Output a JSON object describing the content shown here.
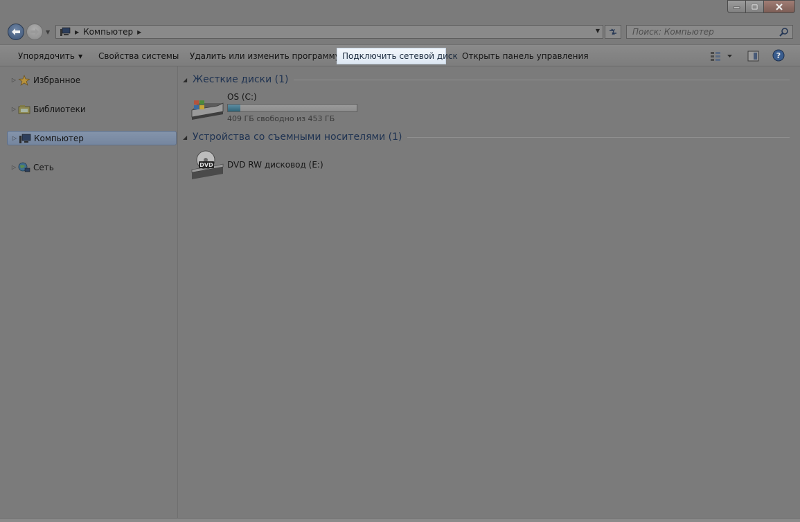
{
  "window": {
    "caption_buttons": [
      "minimize-icon",
      "maximize-icon",
      "close-icon"
    ]
  },
  "address_bar": {
    "location": "Компьютер",
    "search_placeholder": "Поиск: Компьютер"
  },
  "toolbar": {
    "items": [
      {
        "label": "Упорядочить",
        "has_dropdown": true
      },
      {
        "label": "Свойства системы"
      },
      {
        "label": "Удалить или изменить программу"
      },
      {
        "label": "Подключить сетевой диск",
        "highlighted": true
      },
      {
        "label": "Открыть панель управления"
      }
    ],
    "right_icons": [
      "view-options-icon",
      "preview-pane-icon",
      "help-icon"
    ]
  },
  "nav_pane": {
    "items": [
      {
        "label": "Избранное",
        "icon": "star-icon"
      },
      {
        "label": "Библиотеки",
        "icon": "libraries-icon"
      },
      {
        "label": "Компьютер",
        "icon": "computer-icon",
        "selected": true
      },
      {
        "label": "Сеть",
        "icon": "network-icon"
      }
    ]
  },
  "content": {
    "groups": [
      {
        "title": "Жесткие диски (1)",
        "drives": [
          {
            "name": "OS (C:)",
            "free_text": "409 ГБ свободно из 453 ГБ",
            "used_fraction": 0.097,
            "icon": "hard-drive-icon"
          }
        ]
      },
      {
        "title": "Устройства со съемными носителями (1)",
        "drives": [
          {
            "name": "DVD RW дисковод (E:)",
            "icon": "dvd-drive-icon",
            "icon_text": "DVD"
          }
        ]
      }
    ]
  },
  "colors": {
    "accent_blue": "#1e3251",
    "highlight": "#e6eef7",
    "selection": "#7a8ba4"
  }
}
